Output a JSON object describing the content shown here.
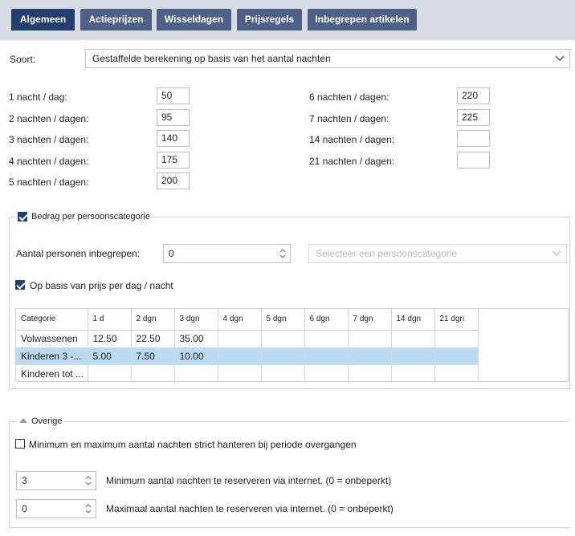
{
  "tabs": [
    {
      "label": "Algemeen",
      "active": true
    },
    {
      "label": "Actieprijzen",
      "active": false
    },
    {
      "label": "Wisseldagen",
      "active": false
    },
    {
      "label": "Prijsregels",
      "active": false
    },
    {
      "label": "Inbegrepen artikelen",
      "active": false
    }
  ],
  "soort": {
    "label": "Soort:",
    "value": "Gestaffelde berekening op basis van het aantal nachten"
  },
  "nights_left": [
    {
      "label": "1 nacht / dag:",
      "value": "50"
    },
    {
      "label": "2 nachten / dagen:",
      "value": "95"
    },
    {
      "label": "3 nachten / dagen:",
      "value": "140"
    },
    {
      "label": "4 nachten / dagen:",
      "value": "175"
    },
    {
      "label": "5 nachten / dagen:",
      "value": "200"
    }
  ],
  "nights_right": [
    {
      "label": "6 nachten / dagen:",
      "value": "220"
    },
    {
      "label": "7 nachten / dagen:",
      "value": "225"
    },
    {
      "label": "14 nachten / dagen:",
      "value": ""
    },
    {
      "label": "21 nachten / dagen:",
      "value": ""
    }
  ],
  "persons_section": {
    "legend": "Bedrag per persoonscategorie",
    "checked": true,
    "included_label": "Aantal personen inbegrepen:",
    "included_value": "0",
    "category_placeholder": "Selecteer een persoonscategorie",
    "per_day_label": "Op basis van prijs per dag / nacht",
    "per_day_checked": true,
    "table": {
      "headers": [
        "Categorie",
        "1 d",
        "2 dgn",
        "3 dgn",
        "4 dgn",
        "5 dgn",
        "6 dgn",
        "7 dgn",
        "14 dgn",
        "21 dgn"
      ],
      "rows": [
        [
          "Volwassenen",
          "12.50",
          "22.50",
          "35.00",
          "",
          "",
          "",
          "",
          "",
          ""
        ],
        [
          "Kinderen 3 -...",
          "5.00",
          "7.50",
          "10.00",
          "",
          "",
          "",
          "",
          "",
          ""
        ],
        [
          "Kinderen tot ...",
          "",
          "",
          "",
          "",
          "",
          "",
          "",
          "",
          ""
        ]
      ]
    }
  },
  "overige": {
    "legend": "Overige",
    "strict_label": "Minimum en maximum aantal nachten strict hanteren bij periode overgangen",
    "strict_checked": false,
    "min_value": "3",
    "min_label": "Minimum aantal nachten te reserveren via internet. (0 = onbeperkt)",
    "max_value": "0",
    "max_label": "Maximaal aantal nachten te reserveren via internet. (0 = onbeperkt)"
  },
  "colors": {
    "tab_active": "#243e70",
    "tab": "#4f6088",
    "tabbar": "#d6dbe4",
    "row_selected": "#bcd9f2",
    "checkbox": "#1f3f78"
  }
}
